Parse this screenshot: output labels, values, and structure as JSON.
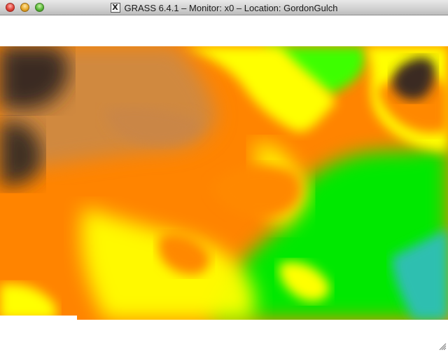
{
  "window": {
    "title": "GRASS 6.4.1 – Monitor: x0 – Location: GordonGulch",
    "app_icon": "x11-icon",
    "app_icon_glyph": "X",
    "controls": [
      "close-button",
      "minimize-button",
      "zoom-button"
    ]
  },
  "map": {
    "layer": "elevation raster",
    "color_ramp": [
      "#00e000",
      "#7aff00",
      "#ffff00",
      "#ff8000",
      "#c88240",
      "#3a2c20"
    ],
    "color_ramp_extra": [
      "#2fbfb0"
    ]
  }
}
